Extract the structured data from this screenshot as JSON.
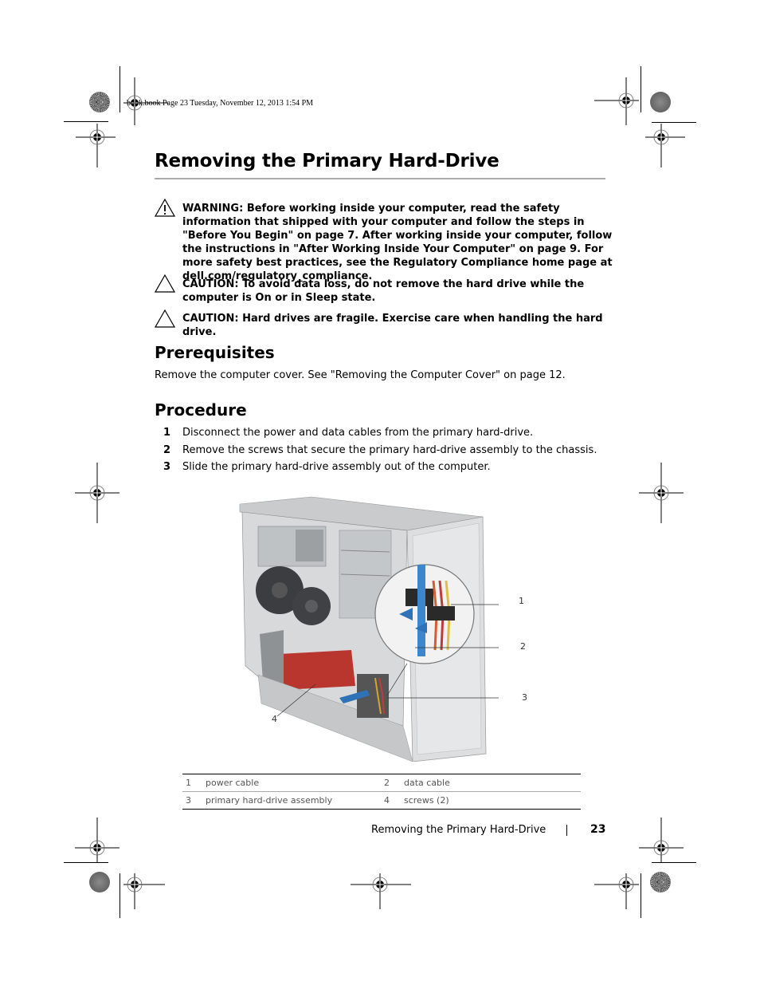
{
  "print_marks": {
    "slug_line": "book.book  Page 23  Tuesday, November 12, 2013  1:54 PM"
  },
  "page": {
    "title": "Removing the Primary Hard-Drive",
    "notices": [
      {
        "type": "warning",
        "icon": "warning-triangle-icon",
        "text": "WARNING:  Before working inside your computer, read the safety information that shipped with your computer and follow the steps in \"Before You Begin\" on page 7. After working inside your computer, follow the instructions in \"After Working Inside Your Computer\" on page 9. For more safety best practices, see the Regulatory Compliance home page at dell.com/regulatory_compliance."
      },
      {
        "type": "caution",
        "icon": "caution-triangle-icon",
        "text": "CAUTION: To avoid data loss, do not remove the hard drive while the computer is On or in Sleep state."
      },
      {
        "type": "caution",
        "icon": "caution-triangle-icon",
        "text": "CAUTION: Hard drives are fragile. Exercise care when handling the hard drive."
      }
    ],
    "prerequisites": {
      "heading": "Prerequisites",
      "text": "Remove the computer cover. See \"Removing the Computer Cover\" on page 12."
    },
    "procedure": {
      "heading": "Procedure",
      "steps": [
        {
          "num": "1",
          "text": "Disconnect the power and data cables from the primary hard-drive."
        },
        {
          "num": "2",
          "text": "Remove the screws that secure the primary hard-drive assembly to the chassis."
        },
        {
          "num": "3",
          "text": "Slide the primary hard-drive assembly out of the computer."
        }
      ]
    },
    "figure": {
      "description": "computer tower with side cover removed, hard-drive cables and screws highlighted",
      "callouts": [
        "1",
        "2",
        "3",
        "4"
      ]
    },
    "legend": [
      [
        {
          "num": "1",
          "label": "power cable"
        },
        {
          "num": "2",
          "label": "data cable"
        }
      ],
      [
        {
          "num": "3",
          "label": "primary hard-drive assembly"
        },
        {
          "num": "4",
          "label": "screws (2)"
        }
      ]
    ],
    "footer": {
      "section": "Removing the Primary Hard-Drive",
      "page_number": "23"
    }
  }
}
